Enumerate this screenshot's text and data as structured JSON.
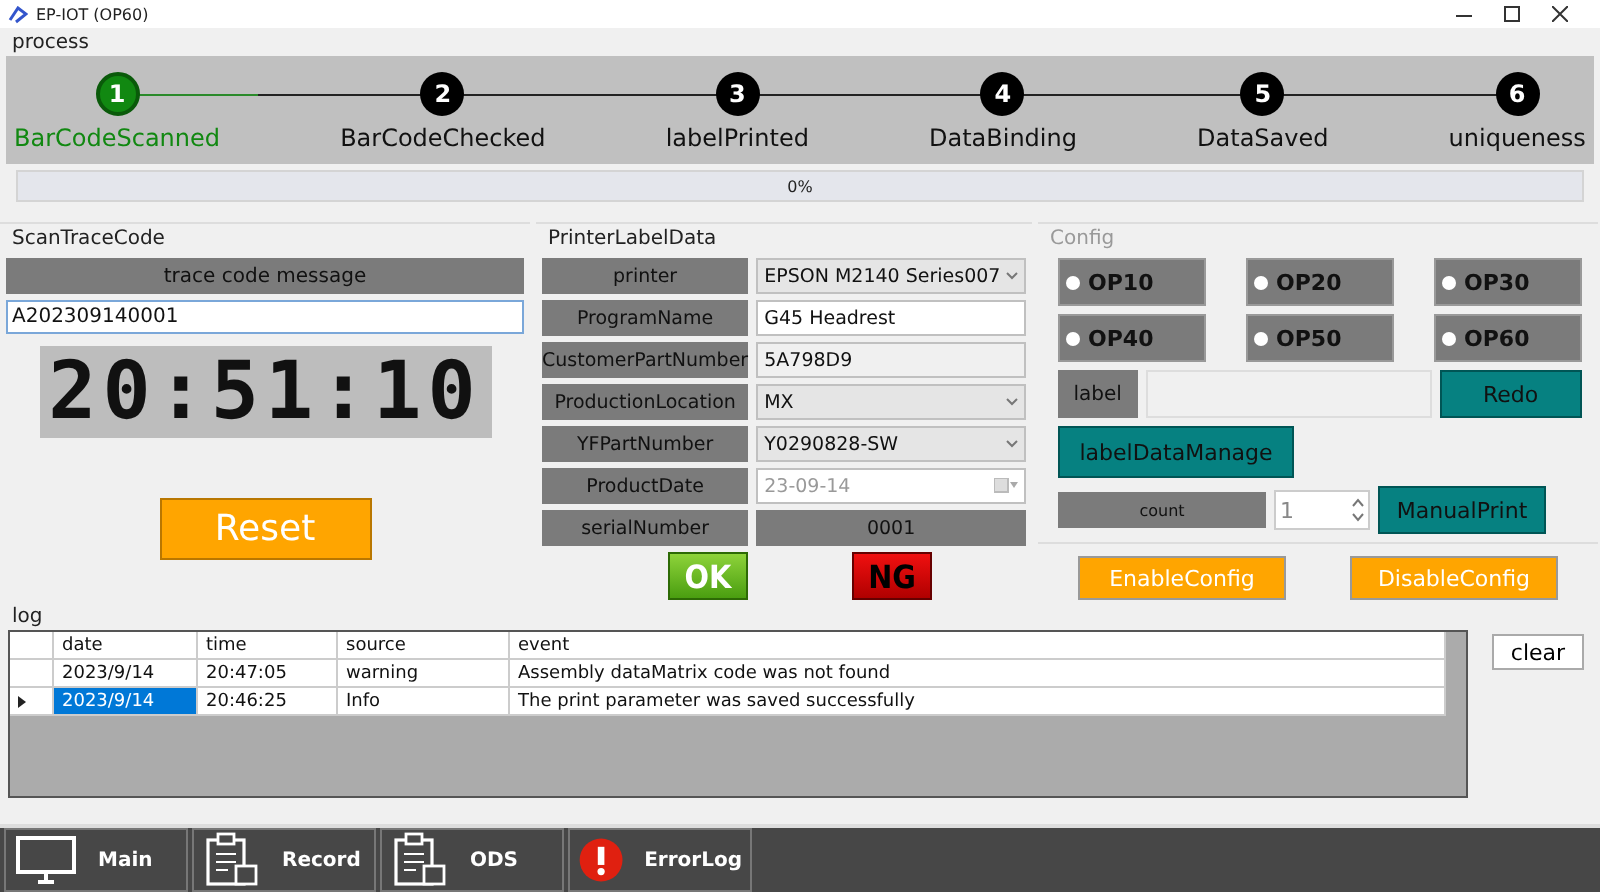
{
  "window": {
    "title": "EP-IOT (OP60)"
  },
  "process": {
    "label": "process",
    "progress_text": "0%",
    "level": 0,
    "steps": [
      {
        "number": "1",
        "label": "BarCodeScanned",
        "done": true
      },
      {
        "number": "2",
        "label": "BarCodeChecked",
        "done": false
      },
      {
        "number": "3",
        "label": "labelPrinted",
        "done": false
      },
      {
        "number": "4",
        "label": "DataBinding",
        "done": false
      },
      {
        "number": "5",
        "label": "DataSaved",
        "done": false
      },
      {
        "number": "6",
        "label": "uniqueness",
        "done": false
      }
    ]
  },
  "scan": {
    "label": "ScanTraceCode",
    "message_label": "trace code message",
    "trace_code": "A202309140001",
    "clock": "20:51:10",
    "reset": "Reset"
  },
  "printer": {
    "label": "PrinterLabelData",
    "fields": [
      {
        "label": "printer",
        "value": "EPSON M2140 Series007",
        "kind": "select",
        "disabled": false
      },
      {
        "label": "ProgramName",
        "value": "G45 Headrest",
        "kind": "text",
        "disabled": false
      },
      {
        "label": "CustomerPartNumber",
        "value": "5A798D9",
        "kind": "readonly",
        "disabled": false
      },
      {
        "label": "ProductionLocation",
        "value": "MX",
        "kind": "select",
        "disabled": false
      },
      {
        "label": "YFPartNumber",
        "value": "Y0290828-SW",
        "kind": "select",
        "disabled": false
      },
      {
        "label": "ProductDate",
        "value": "23-09-14",
        "kind": "date",
        "disabled": true
      },
      {
        "label": "serialNumber",
        "value": "0001",
        "kind": "plain",
        "disabled": false
      }
    ],
    "ok": "OK",
    "ng": "NG"
  },
  "config": {
    "label": "Config",
    "ops": [
      {
        "label": "OP10",
        "selected": false
      },
      {
        "label": "OP20",
        "selected": false
      },
      {
        "label": "OP30",
        "selected": false
      },
      {
        "label": "OP40",
        "selected": false
      },
      {
        "label": "OP50",
        "selected": false
      },
      {
        "label": "OP60",
        "selected": false
      }
    ],
    "label_caption": "label",
    "redo": "Redo",
    "label_data_manage": "labelDataManage",
    "count_label": "count",
    "count_value": "1",
    "manual_print": "ManualPrint"
  },
  "enable_config": "EnableConfig",
  "disable_config": "DisableConfig",
  "log": {
    "label": "log",
    "columns": [
      "date",
      "time",
      "source",
      "event"
    ],
    "rows": [
      {
        "date": "2023/9/14",
        "time": "20:47:05",
        "source": "warning",
        "event": "Assembly dataMatrix code was not found",
        "selected": false
      },
      {
        "date": "2023/9/14",
        "time": "20:46:25",
        "source": "Info",
        "event": "The print parameter was saved successfully",
        "selected": true
      }
    ],
    "clear": "clear"
  },
  "nav": [
    {
      "label": "Main",
      "kind": "monitor"
    },
    {
      "label": "Record",
      "kind": "clipboard"
    },
    {
      "label": "ODS",
      "kind": "clipboard"
    },
    {
      "label": "ErrorLog",
      "kind": "error"
    }
  ]
}
